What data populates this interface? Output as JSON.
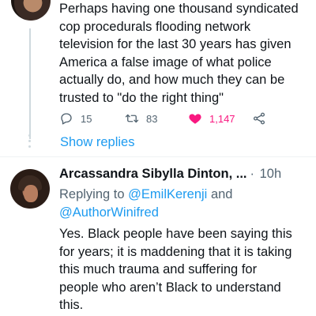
{
  "top_tweet": {
    "text": "Perhaps having one thousand syndicated\ncop procedurals flooding network\ntelevision for the last 30 years has given\nAmerica a false image of what police\nactually do, and how much they can be\ntrusted to \"do the right thing\"",
    "reply_count": "15",
    "retweet_count": "83",
    "like_count": "1,147",
    "like_color": "#f91880",
    "icons": [
      "reply-icon",
      "retweet-icon",
      "heart-icon",
      "share-icon"
    ]
  },
  "show_replies_label": "Show replies",
  "reply_tweet": {
    "author_name": "Arcassandra Sibylla Dinton, ...",
    "separator": "·",
    "time": "10h",
    "replying_prefix": "Replying to",
    "mention_1": "@EmilKerenji",
    "and_word": "and",
    "mention_2": "@AuthorWinifred",
    "text": "Yes. Black people have been saying this\nfor years; it is maddening that it is taking\nthis much trauma and suffering for\npeople who aren’t Black to understand\nthis."
  },
  "colors": {
    "link": "#1d9bf0",
    "secondary_text": "#536471",
    "like_active": "#f91880"
  }
}
